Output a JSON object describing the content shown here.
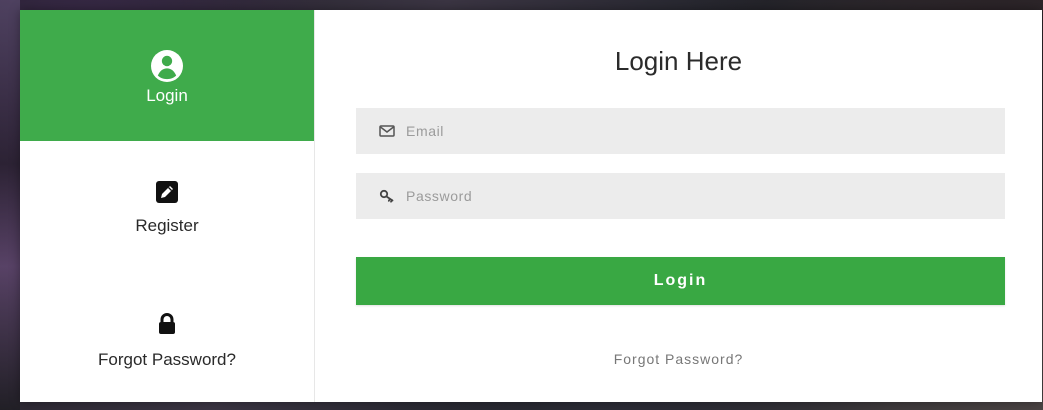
{
  "sidebar": {
    "items": [
      {
        "label": "Login",
        "icon": "user-circle-icon",
        "active": true
      },
      {
        "label": "Register",
        "icon": "edit-icon",
        "active": false
      },
      {
        "label": "Forgot Password?",
        "icon": "lock-icon",
        "active": false
      }
    ]
  },
  "main": {
    "title": "Login Here",
    "email": {
      "placeholder": "Email",
      "value": ""
    },
    "password": {
      "placeholder": "Password",
      "value": ""
    },
    "login_button": "Login",
    "forgot_link": "Forgot Password?"
  },
  "colors": {
    "accent": "#3fab4b",
    "field_bg": "#ececec",
    "text": "#2b2b2b"
  }
}
